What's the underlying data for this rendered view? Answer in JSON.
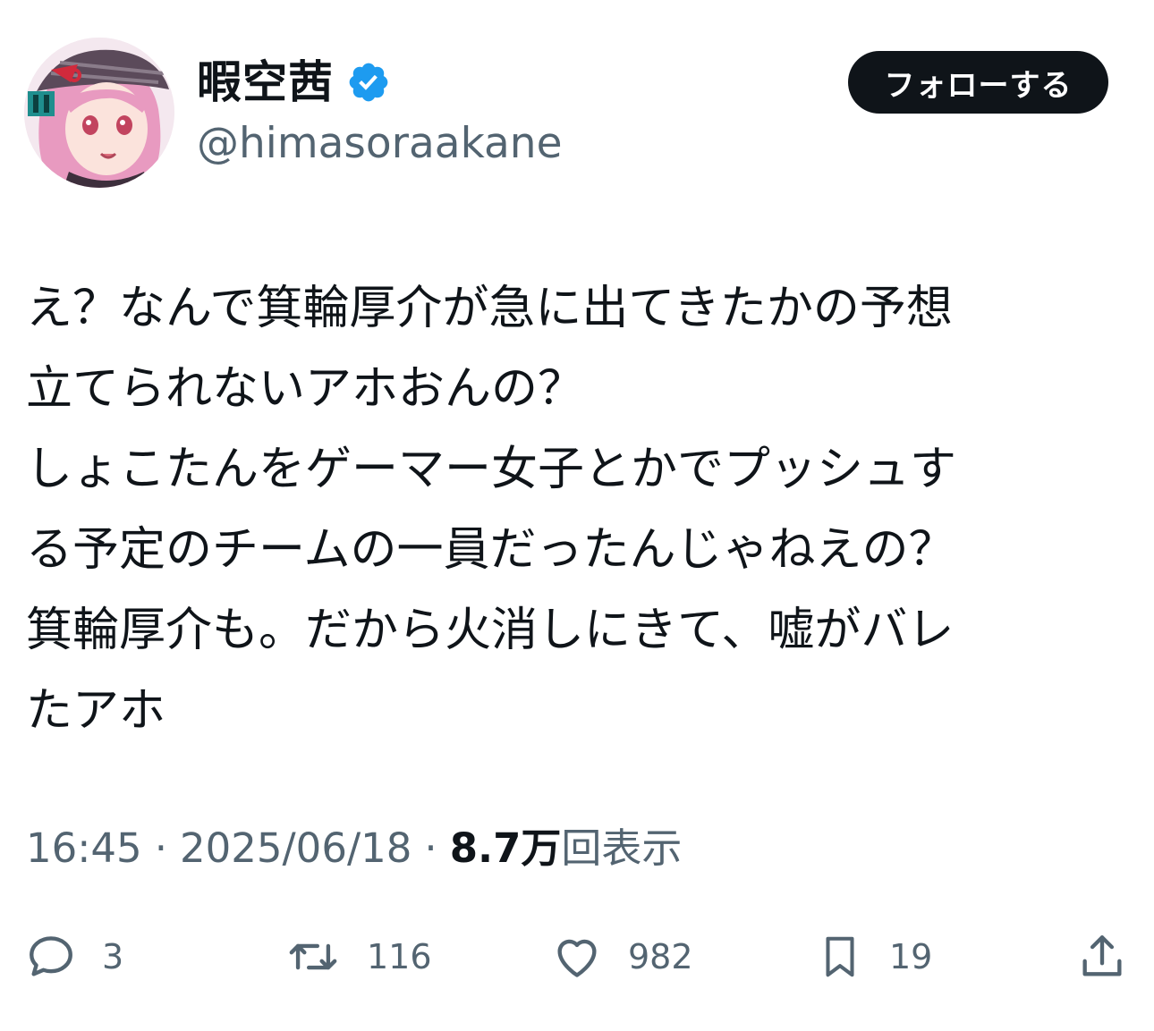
{
  "header": {
    "display_name": "暇空茜",
    "handle": "@himasoraakane",
    "follow_label": "フォローする"
  },
  "tweet": {
    "lines": [
      "え？なんで箕輪厚介が急に出てきたかの予想",
      "立てられないアホおんの？",
      "しょこたんをゲーマー女子とかでプッシュす",
      "る予定のチームの一員だったんじゃねえの？",
      "箕輪厚介も。だから火消しにきて、嘘がバレ",
      "たアホ"
    ]
  },
  "meta": {
    "time": "16:45",
    "date": "2025/06/18",
    "views": "8.7万",
    "views_label": "回表示",
    "separator": "·"
  },
  "actions": {
    "reply_count": "3",
    "retweet_count": "116",
    "like_count": "982",
    "bookmark_count": "19"
  },
  "colors": {
    "text_primary": "#0f1419",
    "text_secondary": "#536471",
    "verified": "#1d9bf0",
    "button_bg": "#0f1419"
  },
  "icons": {
    "verified": "verified-badge-icon",
    "reply": "reply-icon",
    "retweet": "retweet-icon",
    "like": "heart-icon",
    "bookmark": "bookmark-icon",
    "share": "share-icon"
  }
}
